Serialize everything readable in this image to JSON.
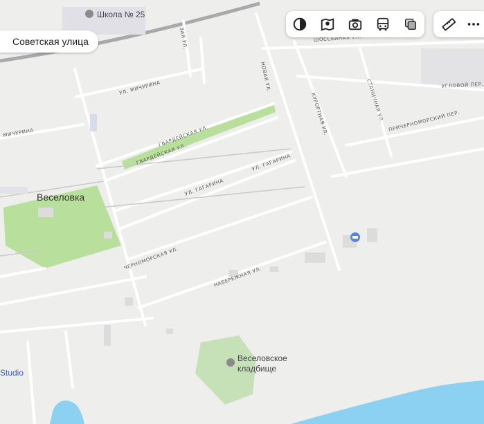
{
  "map": {
    "places": {
      "settlement": "Веселовка"
    },
    "pois": {
      "school": "Школа № 25",
      "cemetery_line1": "Веселовское",
      "cemetery_line2": "кладбище",
      "studio": "Studio"
    },
    "streets": {
      "michurina_1": "УЛ. МИЧУРИНА",
      "michurina_2": "МИЧУРИНА",
      "gvardeyskaya_1": "ГВАРДЕЙСКАЯ УЛ.",
      "gvardeyskaya_2": "ГВАРДЕЙСКАЯ УЛ.",
      "gagarina_1": "УЛ. ГАГАРИНА",
      "gagarina_2": "УЛ. ГАГАРИНА",
      "chernomorskaya": "ЧЕРНОМОРСКАЯ УЛ.",
      "naberezhnaya": "НАБЕРЕЖНАЯ УЛ.",
      "novaya": "НОВАЯ УЛ.",
      "kurortnaya": "КУРОРТНАЯ УЛ.",
      "stanichnaya": "СТАНИЧНАЯ УЛ.",
      "shosseynaya": "ШОССЕЙНАЯ УЛ.",
      "uglovoy": "УГЛОВОЙ ПЕР.",
      "prichernomorsky": "ПРИЧЕРНОМОРСКИЙ ПЕР.",
      "top_partial": "ЗАЯ УЛ."
    }
  },
  "search": {
    "selected_street": "Советская улица"
  },
  "toolbar": {
    "buttons": [
      "layers-icon",
      "map-icon",
      "panorama-icon",
      "transit-icon",
      "traffic-icon"
    ],
    "side_buttons": [
      "ruler-icon",
      "more-icon"
    ]
  },
  "colors": {
    "park": "#b9df9c",
    "water": "#8cd0f2",
    "accent": "#ff3333"
  }
}
